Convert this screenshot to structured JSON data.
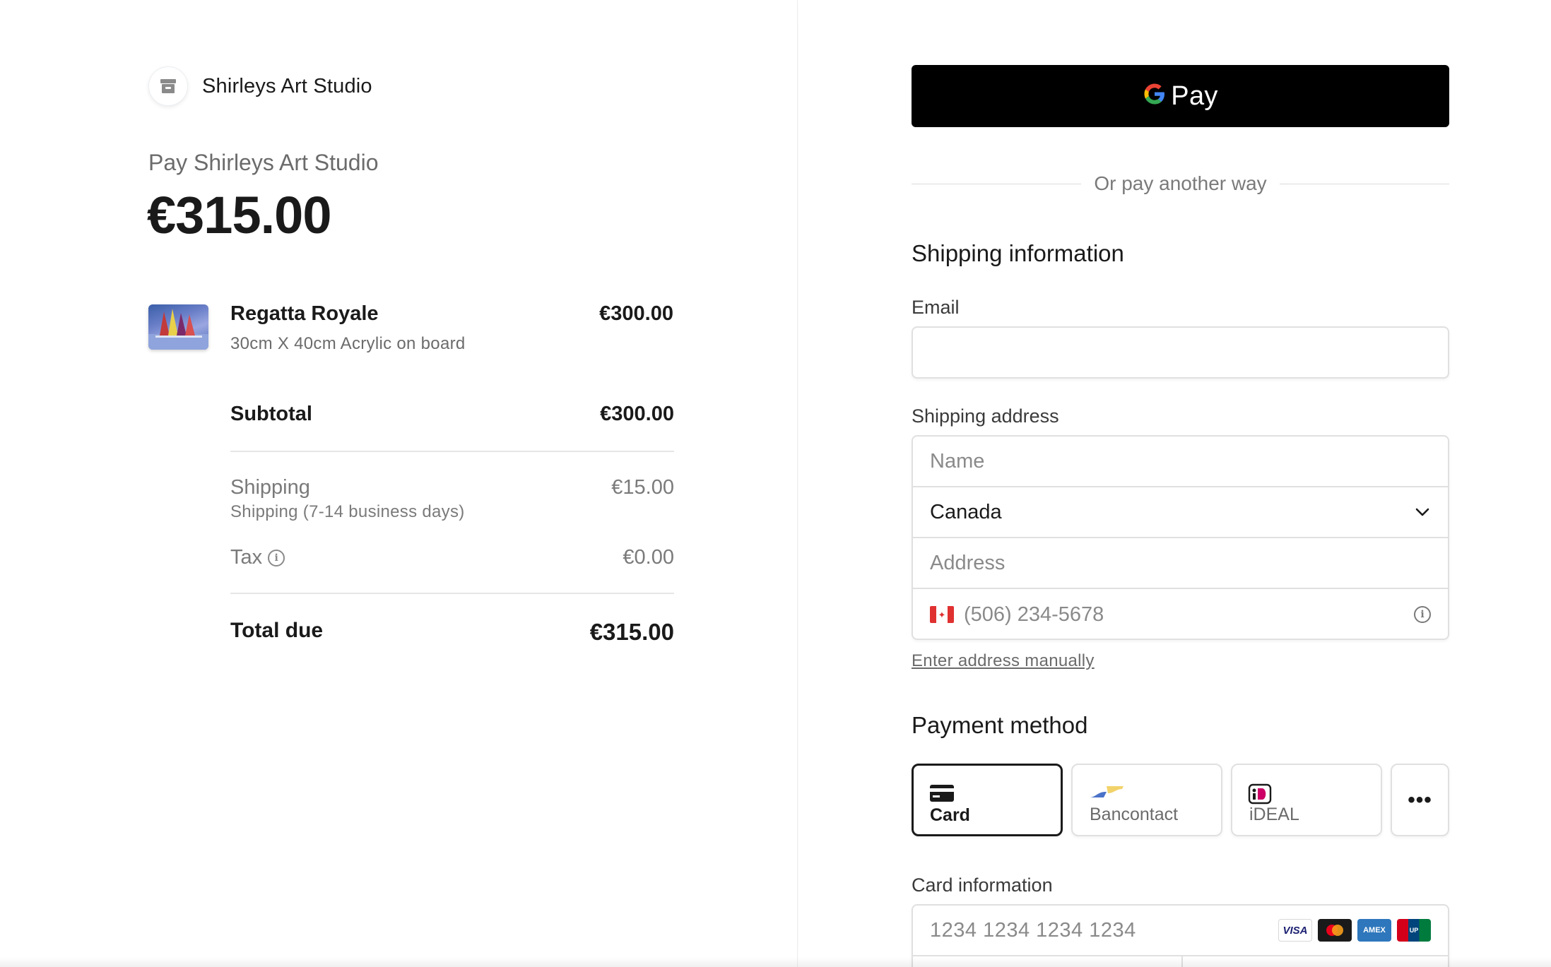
{
  "merchant": {
    "name": "Shirleys Art Studio",
    "icon": "store-icon"
  },
  "summary": {
    "pay_to": "Pay Shirleys Art Studio",
    "total_amount": "€315.00",
    "item": {
      "name": "Regatta Royale",
      "description": "30cm X 40cm Acrylic on board",
      "price": "€300.00"
    },
    "subtotal_label": "Subtotal",
    "subtotal_value": "€300.00",
    "shipping_label": "Shipping",
    "shipping_detail": "Shipping (7-14 business days)",
    "shipping_value": "€15.00",
    "tax_label": "Tax",
    "tax_value": "€0.00",
    "total_label": "Total due",
    "total_value": "€315.00"
  },
  "checkout": {
    "gpay_label": "Pay",
    "divider_text": "Or pay another way",
    "shipping_title": "Shipping information",
    "email_label": "Email",
    "email_value": "",
    "address_label": "Shipping address",
    "name_placeholder": "Name",
    "country_value": "Canada",
    "address_placeholder": "Address",
    "phone_placeholder": "(506) 234-5678",
    "manual_link": "Enter address manually",
    "payment_title": "Payment method",
    "methods": [
      {
        "label": "Card",
        "icon": "credit-card-icon",
        "selected": true
      },
      {
        "label": "Bancontact",
        "icon": "bancontact-icon",
        "selected": false
      },
      {
        "label": "iDEAL",
        "icon": "ideal-icon",
        "selected": false
      }
    ],
    "more_label": "•••",
    "card_info_label": "Card information",
    "card_number_placeholder": "1234 1234 1234 1234",
    "card_brands": [
      "VISA",
      "Mastercard",
      "AMEX",
      "UnionPay"
    ]
  },
  "colors": {
    "accent": "#1a1a1a",
    "gpay_bg": "#000000",
    "muted_text": "#6b6b6b",
    "border": "#e0e0e0"
  }
}
